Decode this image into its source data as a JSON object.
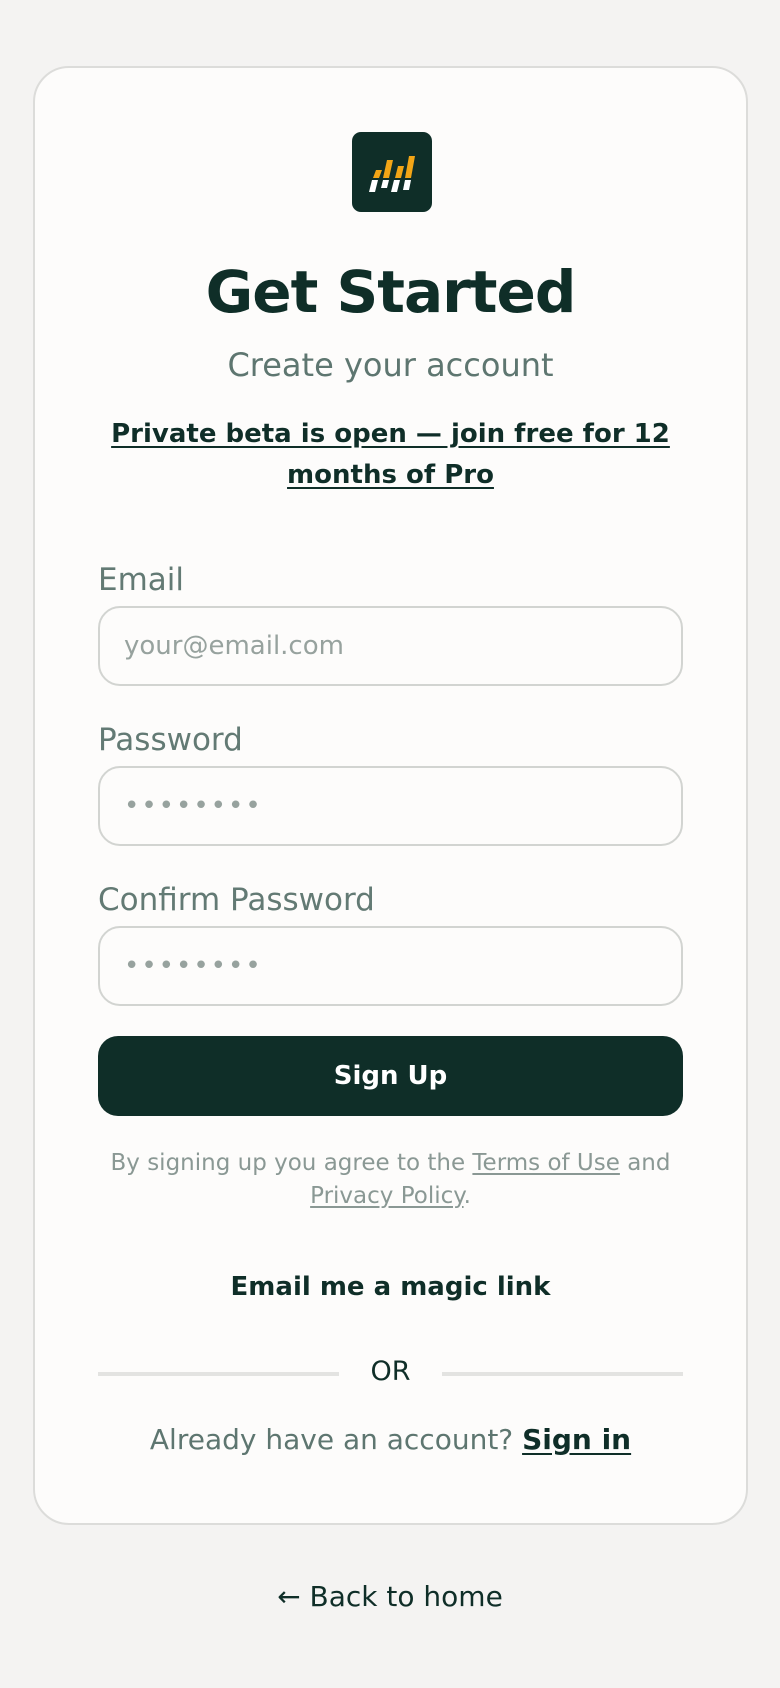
{
  "brand": {
    "logo_icon": "bar-chart-logo-icon",
    "logo_bg": "#0f2e28",
    "logo_accent": "#f2a516"
  },
  "header": {
    "title": "Get Started",
    "subtitle": "Create your account",
    "beta_link": "Private beta is open — join free for 12 months of Pro"
  },
  "form": {
    "email_label": "Email",
    "email_placeholder": "your@email.com",
    "password_label": "Password",
    "password_placeholder": "••••••••",
    "confirm_label": "Confirm Password",
    "confirm_placeholder": "••••••••",
    "submit_label": "Sign Up"
  },
  "legal": {
    "prefix": "By signing up you agree to the ",
    "terms_link": "Terms of Use",
    "and": " and ",
    "privacy_link": "Privacy Policy",
    "suffix": "."
  },
  "magic_link": "Email me a magic link",
  "divider_text": "OR",
  "signin": {
    "prompt": "Already have an account? ",
    "link": "Sign in"
  },
  "back_link": "← Back to home",
  "colors": {
    "primary": "#0f2e28",
    "page_bg": "#f4f3f2",
    "card_bg": "#fdfcfb"
  }
}
